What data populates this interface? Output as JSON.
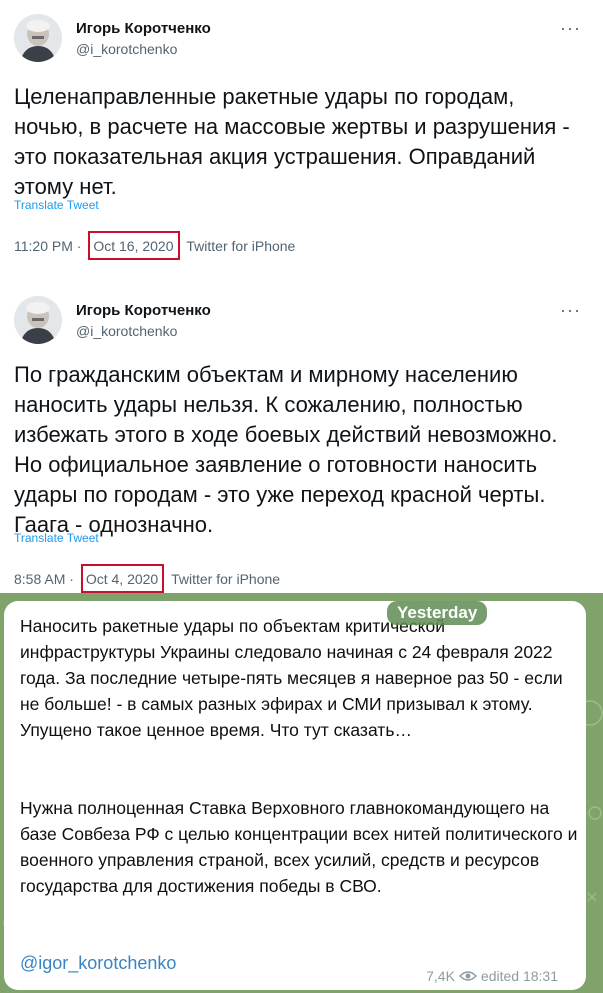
{
  "tweets": [
    {
      "author_name": "Игорь Коротченко",
      "handle": "@i_korotchenko",
      "more_label": "···",
      "text": "Целенаправленные ракетные удары по городам, ночью, в расчете на массовые жертвы и разрушения - это показательная акция устрашения. Оправданий этому нет.",
      "translate_label": "Translate Tweet",
      "time": "11:20 PM",
      "separator": "·",
      "date": "Oct 16, 2020",
      "source": "Twitter for iPhone"
    },
    {
      "author_name": "Игорь Коротченко",
      "handle": "@i_korotchenko",
      "more_label": "···",
      "text": "По гражданским объектам и мирному населению наносить удары нельзя. К сожалению, полностью избежать этого в ходе боевых действий невозможно. Но официальное заявление о готовности наносить удары по городам - это уже переход красной черты. Гаага - однозначно.",
      "translate_label": "Translate Tweet",
      "time": "8:58 AM",
      "separator": "·",
      "date": "Oct 4, 2020",
      "source": "Twitter for iPhone"
    }
  ],
  "telegram": {
    "date_badge": "Yesterday",
    "paragraph_1": "Наносить ракетные удары по объектам критической инфраструктуры Украины следовало начиная с 24 февраля 2022 года. За последние четыре-пять месяцев я наверное раз 50 - если не больше! - в самых разных эфирах и СМИ призывал к этому. Упущено такое ценное время. Что тут сказать…",
    "paragraph_2": "Нужна полноценная Ставка Верховного главнокомандующего  на базе Совбеза РФ с целью концентрации всех нитей политического и военного управления страной, всех усилий, средств и ресурсов государства для достижения победы в СВО.",
    "channel_link": "@igor_korotchenko",
    "views": "7,4K",
    "edited_time": "edited 18:31"
  },
  "colors": {
    "highlight_box": "#c8102e",
    "link_blue": "#1d9bf0",
    "telegram_bg": "#7fa36a"
  }
}
